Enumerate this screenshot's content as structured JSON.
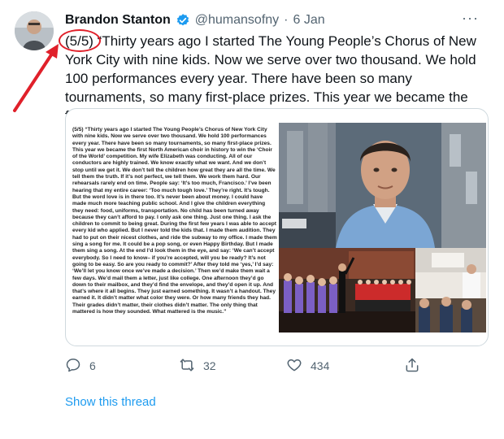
{
  "tweet": {
    "author_name": "Brandon Stanton",
    "handle": "@humansofny",
    "separator": "·",
    "date": "6 Jan",
    "more_label": "···",
    "text": "(5/5) “Thirty years ago I started The Young People’s Chorus of New York City with nine kids. Now we serve over two thousand. We hold 100 performances every year. There have been so many tournaments, so many first-place prizes. This year we became the first...\"",
    "media_text": "(5/5) “Thirty years ago I started The Young People’s Chorus of New York City with nine kids. Now we serve over two thousand. We hold 100 performances every year. There have been so many tournaments, so many first-place prizes. This year we became the first North American choir in history to win the ‘Choir of the World’ competition. My wife Elizabeth was conducting. All of our conductors are highly trained. We know exactly what we want. And we don’t stop until we get it. We don’t tell the children how great they are all the time. We tell them the truth. If it’s not perfect, we tell them. We work them hard. Our rehearsals rarely end on time. People say: ‘It’s too much, Francisco.’ I’ve been hearing that my entire career: ‘Too much tough love.’ They’re right. It’s tough. But the word love is in there too. It’s never been about money. I could have made much more teaching public school. And I give the children everything they need: food, uniforms, transportation. No child has been turned away because they can’t afford to pay. I only ask one thing. Just one thing. I ask the children to commit to being great. During the first few years I was able to accept every kid who applied. But I never told the kids that. I made them audition. They had to put on their nicest clothes, and ride the subway to my office. I made them sing a song for me. It could be a pop song, or even Happy Birthday. But I made them sing a song. At the end I’d look them in the eye, and say: ‘We can’t accept everybody. So I need to know– if you’re accepted, will you be ready? It’s not going to be easy. So are you ready to commit?’ After they told me ‘yes,’ I’d say: ‘We’ll let you know once we’ve made a decision.’ Then we’d make them wait a few days. We’d mail them a letter, just like college. One afternoon they’d go down to their mailbox, and they’d find the envelope, and they’d open it up. And that’s where it all begins. They just earned something. It wasn’t a handout. They earned it. It didn’t matter what color they were. Or how many friends they had. Their grades didn’t matter, their clothes didn’t matter. The only thing that mattered is how they sounded. What mattered is the music.”",
    "replies": "6",
    "retweets": "32",
    "likes": "434",
    "show_thread": "Show this thread"
  },
  "icons": [
    "verified-badge-icon",
    "more-icon",
    "reply-icon",
    "retweet-icon",
    "like-icon",
    "share-icon"
  ],
  "colors": {
    "accent": "#1d9bf0",
    "annotation": "#e0202a",
    "muted": "#536471"
  }
}
